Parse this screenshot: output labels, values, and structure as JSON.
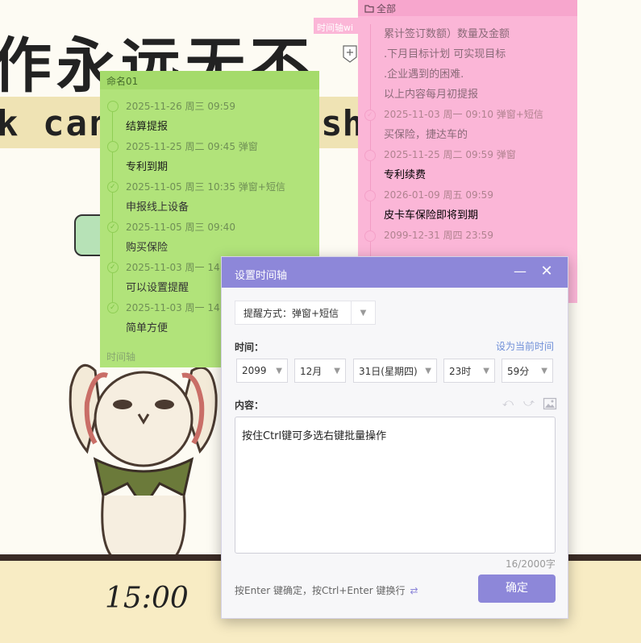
{
  "wallpaper": {
    "headline": "作永远无不",
    "subline": "k can r",
    "subline_tail": "sh",
    "clock": "15:00"
  },
  "note_pink": {
    "header": "全部",
    "side_tab": "时间轴wi",
    "rows": [
      {
        "text": "累计签订数额）数量及金额",
        "kind": "dim",
        "dot": false
      },
      {
        "text": ".下月目标计划     可实现目标",
        "kind": "dim",
        "dot": false
      },
      {
        "text": ".企业遇到的困难.",
        "kind": "dim",
        "dot": false
      },
      {
        "text": "以上内容每月初提报",
        "kind": "dim",
        "dot": false
      },
      {
        "text": "2025-11-03 周一 09:10  弹窗+短信",
        "kind": "meta",
        "dot": true,
        "done": true
      },
      {
        "text": "买保险，捷达车的",
        "kind": "dim",
        "dot": false
      },
      {
        "text": "2025-11-25 周二 09:59  弹窗",
        "kind": "meta",
        "dot": true,
        "done": false
      },
      {
        "text": "专利续费",
        "kind": "title",
        "dot": false
      },
      {
        "text": "2026-01-09 周五 09:59",
        "kind": "meta",
        "dot": true,
        "done": false
      },
      {
        "text": "皮卡车保险即将到期",
        "kind": "title",
        "dot": false
      },
      {
        "text": "2099-12-31 周四 23:59",
        "kind": "meta",
        "dot": true,
        "done": false
      }
    ]
  },
  "note_green": {
    "header": "命名01",
    "footer": "时间轴",
    "rows": [
      {
        "text": "2025-11-26 周三 09:59",
        "kind": "meta",
        "dot": true,
        "done": false
      },
      {
        "text": "结算提报",
        "kind": "title",
        "dot": false
      },
      {
        "text": "2025-11-25 周二 09:45  弹窗",
        "kind": "meta",
        "dot": true,
        "done": false
      },
      {
        "text": "专利到期",
        "kind": "title",
        "dot": false
      },
      {
        "text": "2025-11-05 周三 10:35  弹窗+短信",
        "kind": "meta",
        "dot": true,
        "done": true
      },
      {
        "text": "申报线上设备",
        "kind": "dim",
        "dot": false
      },
      {
        "text": "2025-11-05 周三 09:40",
        "kind": "meta",
        "dot": true,
        "done": true
      },
      {
        "text": "购买保险",
        "kind": "dim",
        "dot": false
      },
      {
        "text": "2025-11-03 周一 14:5",
        "kind": "meta",
        "dot": true,
        "done": true
      },
      {
        "text": "可以设置提醒",
        "kind": "dim",
        "dot": false
      },
      {
        "text": "2025-11-03 周一 14:5",
        "kind": "meta",
        "dot": true,
        "done": true
      },
      {
        "text": "简单方便",
        "kind": "dim",
        "dot": false
      }
    ]
  },
  "dialog": {
    "title": "设置时间轴",
    "reminder_mode": "提醒方式：弹窗+短信",
    "time_label": "时间：",
    "set_now_link": "设为当前时间",
    "year": "2099",
    "month": "12月",
    "day": "31日(星期四)",
    "hour": "23时",
    "minute": "59分",
    "content_label": "内容：",
    "content_text": "按住Ctrl键可多选右键批量操作",
    "char_count": "16/2000字",
    "hint": "按Enter 键确定，按Ctrl+Enter 键换行",
    "confirm_label": "确定"
  },
  "colors": {
    "accent": "#8d87d9",
    "green_note": "#b1e37a",
    "pink_note": "#fbb6d7",
    "link": "#6f8fd8"
  },
  "icons": [
    "folder-icon",
    "add-icon",
    "minimize-icon",
    "close-icon",
    "undo-icon",
    "redo-icon",
    "image-icon",
    "swap-icon",
    "check-icon",
    "chevron-down-icon"
  ]
}
